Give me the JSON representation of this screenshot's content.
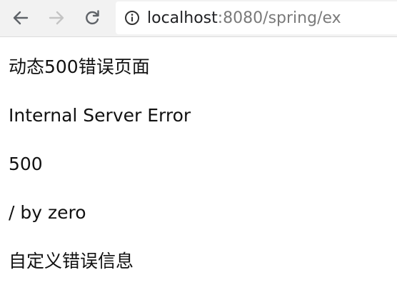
{
  "browser": {
    "url_host": "localhost",
    "url_rest": ":8080/spring/ex",
    "icons": {
      "back": "back-arrow-icon",
      "forward": "forward-arrow-icon",
      "reload": "reload-icon",
      "info": "info-icon"
    }
  },
  "page": {
    "title": "动态500错误页面",
    "error": "Internal Server Error",
    "status": "500",
    "message": "/ by zero",
    "custom_message": "自定义错误信息"
  }
}
